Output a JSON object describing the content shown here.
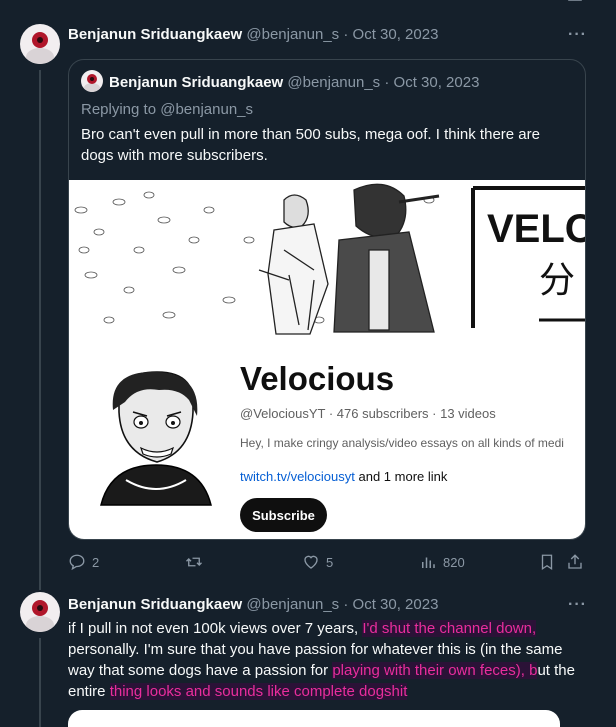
{
  "top_icon": "share-icon",
  "tweet1": {
    "author_name": "Benjanun Sriduangkaew",
    "handle": "@benjanun_s",
    "separator": "·",
    "date": "Oct 30, 2023",
    "more_icon": "more-icon",
    "quote": {
      "author_name": "Benjanun Sriduangkaew",
      "handle": "@benjanun_s",
      "separator": "·",
      "date": "Oct 30, 2023",
      "replying_to": "Replying to @benjanun_s",
      "text": "Bro can't even pull in more than 500 subs, mega oof. I think there are dogs with more subscribers.",
      "youtube_card": {
        "banner_text": "VELOC",
        "banner_glyph": "分",
        "channel_name": "Velocious",
        "meta": "@VelociousYT · 476 subscribers · 13 videos",
        "description": "Hey, I make cringy analysis/video essays on all kinds of medi",
        "link": "twitch.tv/velociousyt",
        "link_suffix": " and 1 more link",
        "subscribe_label": "Subscribe"
      }
    },
    "actions": {
      "replies": "2",
      "retweets": "",
      "likes": "5",
      "views": "820"
    }
  },
  "tweet2": {
    "author_name": "Benjanun Sriduangkaew",
    "handle": "@benjanun_s",
    "separator": "·",
    "date": "Oct 30, 2023",
    "text_parts": {
      "p1": "if I pull in not even 100k views over 7 years, ",
      "h1": "I'd shut the channel down,",
      "p2": " personally. I'm sure that you have passion for whatever this is (in the same way that some dogs have a passion for ",
      "h2": "playing with their own feces), b",
      "p3": "ut the entire ",
      "h3": "thing looks and sounds like complete dogshit"
    }
  },
  "colors": {
    "background": "#15202b",
    "text": "#f7f9f9",
    "muted": "#8b98a5",
    "highlight": "#e92d9d"
  }
}
